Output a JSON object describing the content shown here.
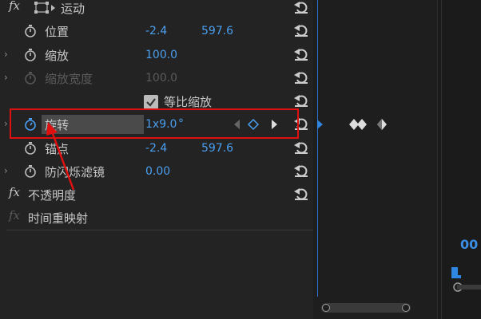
{
  "effects": {
    "motion": {
      "fx_label": "fx",
      "label": "运动"
    },
    "position": {
      "label": "位置",
      "x": "-2.4",
      "y": "597.6"
    },
    "scale": {
      "label": "缩放",
      "value": "100.0"
    },
    "scale_width": {
      "label": "缩放宽度",
      "value": "100.0"
    },
    "uniform_scale": {
      "label": "等比缩放",
      "checked": true
    },
    "rotation": {
      "label": "旋转",
      "value": "1x9.0",
      "unit": "°"
    },
    "anchor": {
      "label": "锚点",
      "x": "-2.4",
      "y": "597.6"
    },
    "anti_flicker": {
      "label": "防闪烁滤镜",
      "value": "0.00"
    },
    "opacity": {
      "fx_label": "fx",
      "label": "不透明度"
    },
    "time_remap": {
      "fx_label": "fx",
      "label": "时间重映射"
    }
  },
  "timeline": {
    "timecode_partial": "00"
  },
  "colors": {
    "accent": "#4a9ff0",
    "highlight": "#e01010",
    "playhead": "#2f6fcf"
  }
}
